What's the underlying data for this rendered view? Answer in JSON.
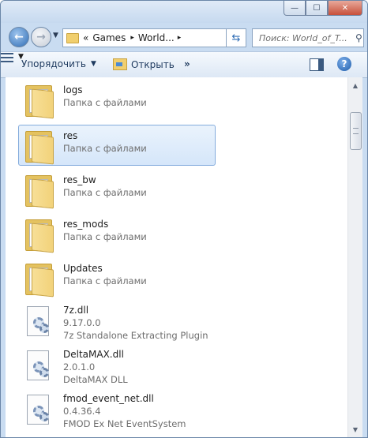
{
  "window": {
    "caption_buttons": {
      "minimize": "—",
      "maximize": "☐",
      "close": "✕"
    }
  },
  "navbar": {
    "back_icon": "back-arrow-icon",
    "forward_icon": "forward-arrow-icon",
    "address": {
      "prefix": "«",
      "segments": [
        "Games",
        "World..."
      ],
      "separator": "▸"
    },
    "search": {
      "placeholder": "Поиск: World_of_T..."
    }
  },
  "toolbar": {
    "organize_label": "Упорядочить",
    "open_label": "Открыть",
    "more_label": "»"
  },
  "items": [
    {
      "kind": "folder",
      "name": "logs",
      "type": "Папка с файлами",
      "selected": false
    },
    {
      "kind": "folder",
      "name": "res",
      "type": "Папка с файлами",
      "selected": true
    },
    {
      "kind": "folder",
      "name": "res_bw",
      "type": "Папка с файлами",
      "selected": false
    },
    {
      "kind": "folder",
      "name": "res_mods",
      "type": "Папка с файлами",
      "selected": false
    },
    {
      "kind": "folder",
      "name": "Updates",
      "type": "Папка с файлами",
      "selected": false
    },
    {
      "kind": "dll",
      "name": "7z.dll",
      "version": "9.17.0.0",
      "description": "7z Standalone Extracting Plugin"
    },
    {
      "kind": "dll",
      "name": "DeltaMAX.dll",
      "version": "2.0.1.0",
      "description": "DeltaMAX DLL"
    },
    {
      "kind": "dll",
      "name": "fmod_event_net.dll",
      "version": "0.4.36.4",
      "description": "FMOD Ex Net EventSystem"
    }
  ],
  "colors": {
    "selection_bg": "#d5e6fa",
    "selection_border": "#84acdd",
    "secondary_text": "#6d6d6d"
  }
}
